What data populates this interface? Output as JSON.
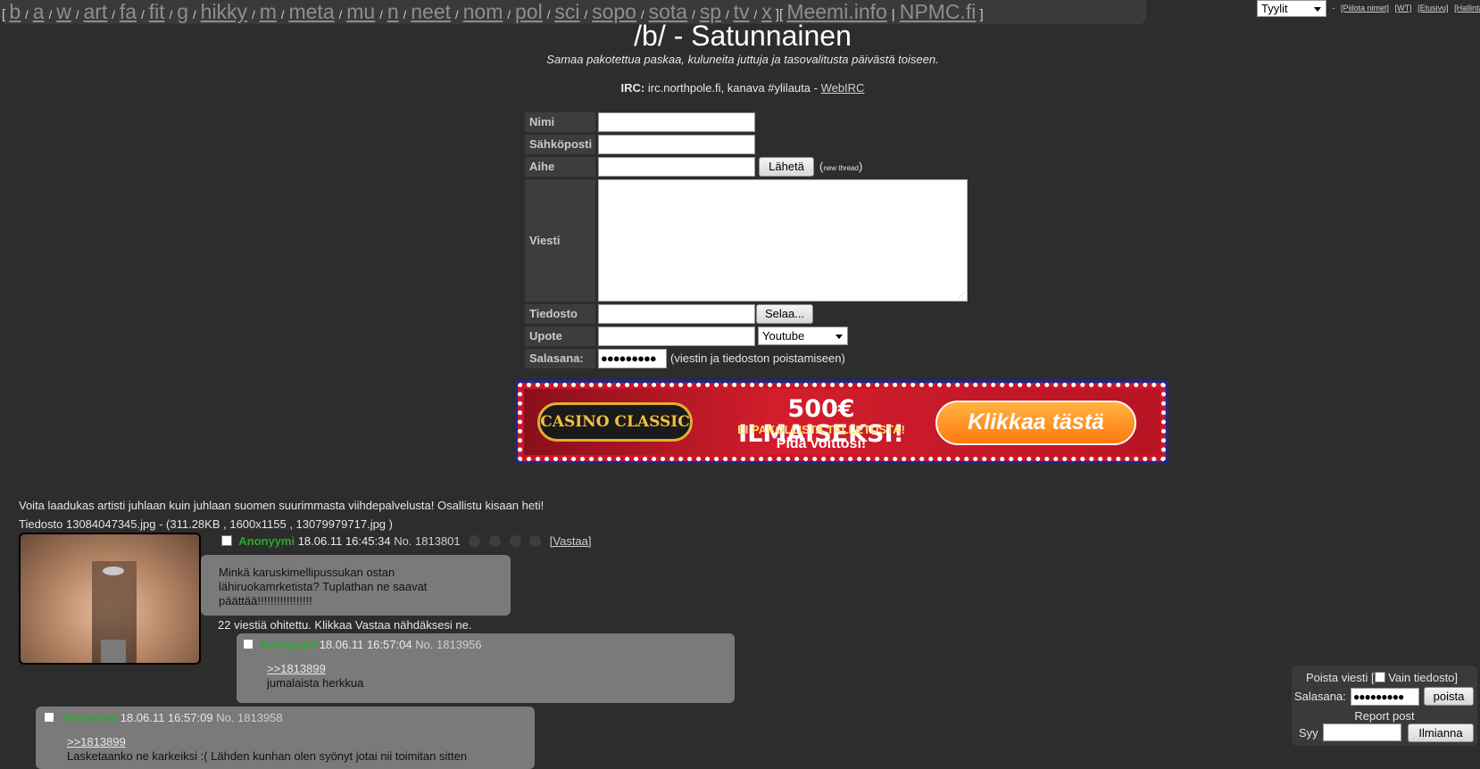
{
  "nav": {
    "boards": [
      "b",
      "a",
      "w",
      "art",
      "fa",
      "fit",
      "g",
      "hikky",
      "m",
      "meta",
      "mu",
      "n",
      "neet",
      "nom",
      "pol",
      "sci",
      "sopo",
      "sota",
      "sp",
      "tv",
      "x"
    ],
    "external": [
      "Meemi.info",
      "NPMC.fi"
    ]
  },
  "topright": {
    "style_select": "Tyylit",
    "links": [
      "[Piilota nimet]",
      "[WT]",
      "[Etusivu]",
      "[Hallinta]"
    ]
  },
  "header": {
    "title": "/b/ - Satunnainen",
    "subtitle": "Samaa pakotettua paskaa, kuluneita juttuja ja tasovalitusta päivästä toiseen.",
    "irc_label": "IRC:",
    "irc_text": "irc.northpole.fi, kanava #ylilauta -",
    "irc_link": "WebIRC"
  },
  "form": {
    "name_label": "Nimi",
    "email_label": "Sähköposti",
    "subject_label": "Aihe",
    "submit_label": "Lähetä",
    "new_thread_note": "(new thread)",
    "message_label": "Viesti",
    "file_label": "Tiedosto",
    "browse_label": "Selaa...",
    "embed_label": "Upote",
    "embed_select": "Youtube",
    "password_label": "Salasana:",
    "password_value": "●●●●●●●●●",
    "password_note": "(viestin ja tiedoston poistamiseen)"
  },
  "banner": {
    "logo_text": "CASINO CLASSIC",
    "headline": "500€ ILMAISEKSI!",
    "line2": "EI PAKOLLISTA TALLETUSTA!",
    "line3": "Pidä voittosi!",
    "cta": "Klikkaa tästä"
  },
  "thread": {
    "announcement": "Voita laadukas artisti juhlaan kuin juhlaan suomen suurimmasta viihdepalvelusta! Osallistu kisaan heti!",
    "file_info": "Tiedosto 13084047345.jpg - (311.28KB , 1600x1155 , 13079979717.jpg )",
    "op": {
      "name": "Anonyymi",
      "date": "18.06.11 16:45:34",
      "no": "No. 1813801",
      "reply_link": "[Vastaa]",
      "body": [
        "Minkä karuskimellipussukan ostan",
        "lähiruokamrketista? Tuplathan ne saavat",
        "päättää!!!!!!!!!!!!!!!!!"
      ]
    },
    "omitted": "22 viestiä ohitettu. Klikkaa Vastaa nähdäksesi ne.",
    "replies": [
      {
        "name": "Anonyymi",
        "date": "18.06.11 16:57:04",
        "no": "No. 1813956",
        "quote": ">>1813899",
        "body": "jumalaista herkkua"
      },
      {
        "name": "Anonyymi",
        "date": "18.06.11 16:57:09",
        "no": "No. 1813958",
        "quote": ">>1813899",
        "body": "Lasketaanko ne karkeiksi :( Lähden kunhan olen syönyt jotai nii toimitan sitten"
      }
    ]
  },
  "delete_box": {
    "title": "Poista viesti [",
    "file_only": "Vain tiedosto]",
    "password_label": "Salasana:",
    "password_value": "●●●●●●●●●",
    "delete_button": "poista",
    "report_title": "Report post",
    "reason_label": "Syy",
    "report_button": "Ilmianna"
  }
}
